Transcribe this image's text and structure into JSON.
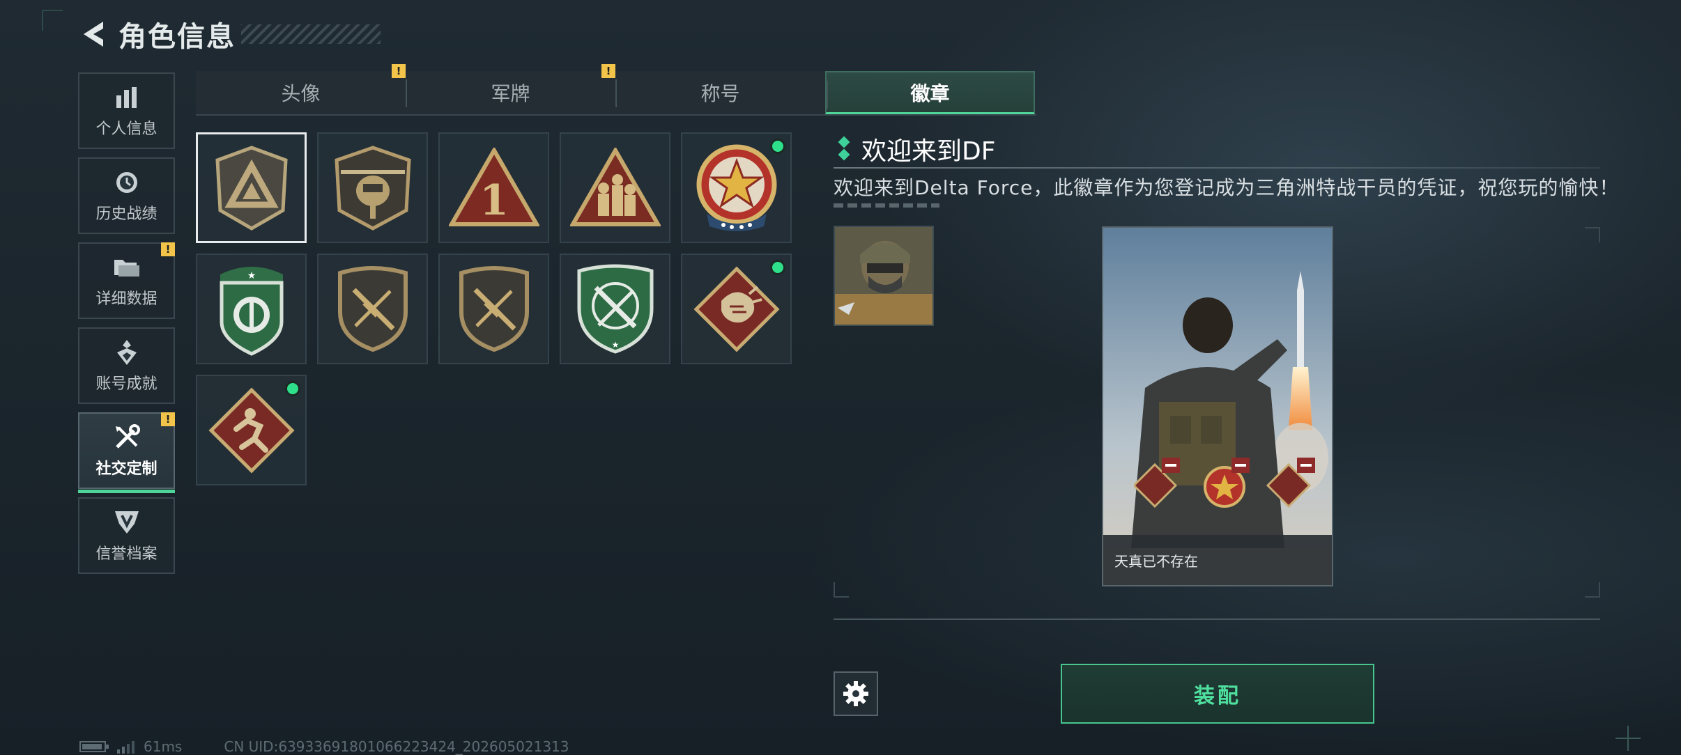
{
  "header": {
    "title": "角色信息"
  },
  "sidebar": {
    "items": [
      {
        "label": "个人信息",
        "icon": "bar-chart-icon",
        "warn": ""
      },
      {
        "label": "历史战绩",
        "icon": "history-clock-icon",
        "warn": ""
      },
      {
        "label": "详细数据",
        "icon": "folder-icon",
        "warn": "!"
      },
      {
        "label": "账号成就",
        "icon": "achievement-icon",
        "warn": ""
      },
      {
        "label": "社交定制",
        "icon": "tools-icon",
        "warn": "!",
        "active": true
      },
      {
        "label": "信誉档案",
        "icon": "credit-shield-icon",
        "warn": ""
      }
    ]
  },
  "tabs": [
    {
      "label": "头像",
      "warn": "!"
    },
    {
      "label": "军牌",
      "warn": "!"
    },
    {
      "label": "称号",
      "warn": ""
    },
    {
      "label": "徽章",
      "warn": "",
      "active": true
    }
  ],
  "badges": [
    {
      "name": "delta-triangle-badge",
      "new": false,
      "selected": true
    },
    {
      "name": "helicopter-badge",
      "new": false
    },
    {
      "name": "number-one-badge",
      "new": false
    },
    {
      "name": "squad-triangle-badge",
      "new": false
    },
    {
      "name": "star-roundel-badge",
      "new": true
    },
    {
      "name": "green-shield-badge",
      "new": false
    },
    {
      "name": "no-rifle-badge",
      "new": false
    },
    {
      "name": "no-rifle-badge-2",
      "new": false
    },
    {
      "name": "green-crossed-knives-badge",
      "new": false
    },
    {
      "name": "dragon-badge",
      "new": true
    },
    {
      "name": "runner-badge",
      "new": true
    }
  ],
  "detail": {
    "name": "欢迎来到DF",
    "description": "欢迎来到Delta Force，此徽章作为您登记成为三角洲特战干员的凭证，祝您玩的愉快！",
    "card_caption": "天真已不存在"
  },
  "buttons": {
    "equip": "装配"
  },
  "status": {
    "ping": "61ms",
    "uid": "CN UID:6393369180106622342​4_202605021313"
  },
  "colors": {
    "accent": "#4fd49a",
    "warning": "#f2c54a",
    "new_dot": "#2fe08b"
  }
}
